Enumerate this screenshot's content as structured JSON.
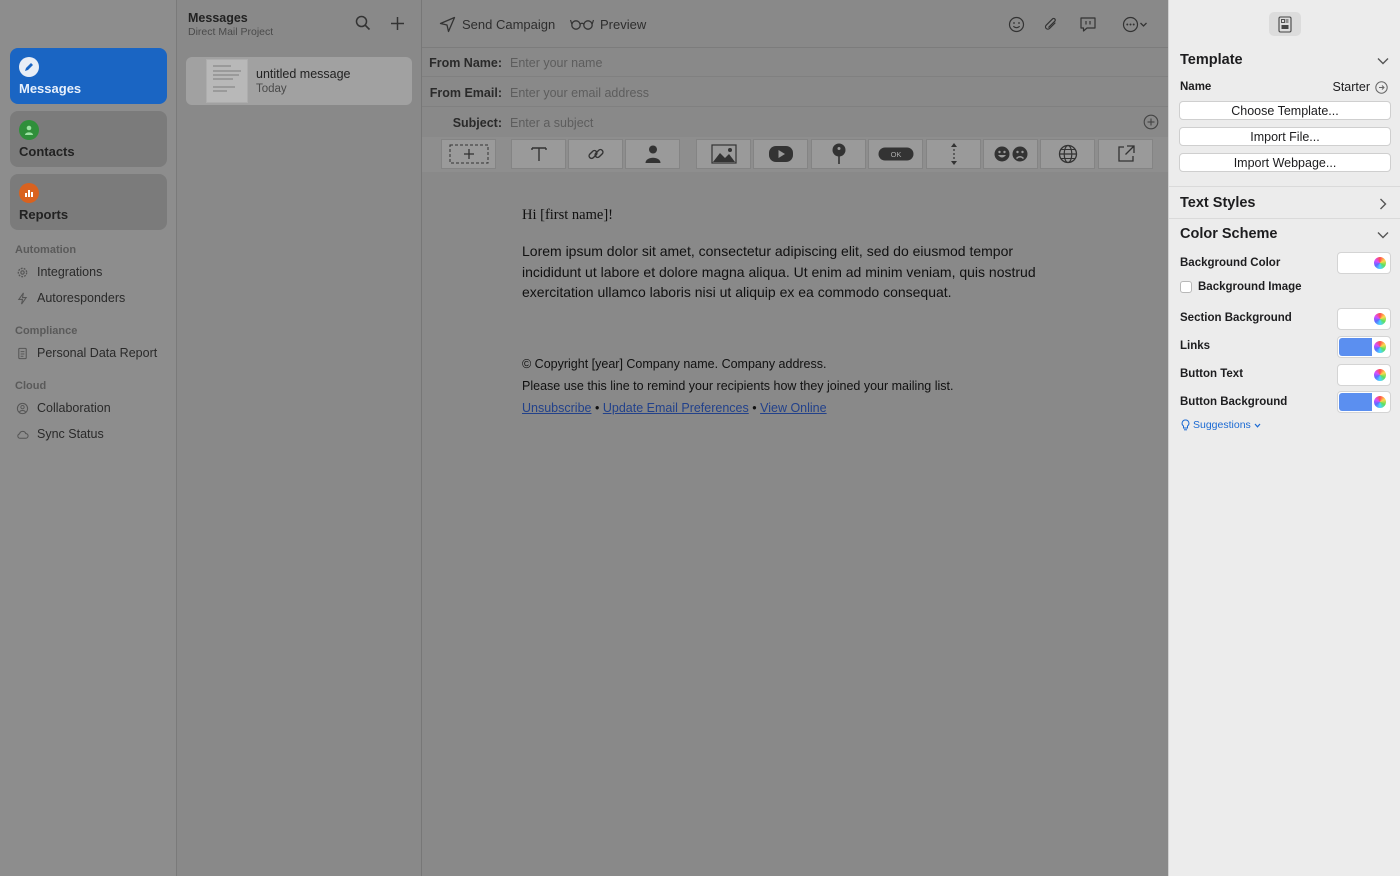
{
  "sidebar": {
    "nav": [
      {
        "label": "Messages",
        "icon": "pencil-icon",
        "active": true
      },
      {
        "label": "Contacts",
        "icon": "person-icon",
        "active": false
      },
      {
        "label": "Reports",
        "icon": "bar-chart-icon",
        "active": false
      }
    ],
    "sections": [
      {
        "title": "Automation",
        "items": [
          {
            "label": "Integrations",
            "icon": "gear-icon"
          },
          {
            "label": "Autoresponders",
            "icon": "bolt-icon"
          }
        ]
      },
      {
        "title": "Compliance",
        "items": [
          {
            "label": "Personal Data Report",
            "icon": "document-icon"
          }
        ]
      },
      {
        "title": "Cloud",
        "items": [
          {
            "label": "Collaboration",
            "icon": "person-circle-icon"
          },
          {
            "label": "Sync Status",
            "icon": "cloud-icon"
          }
        ]
      }
    ]
  },
  "message_list": {
    "title": "Messages",
    "subtitle": "Direct Mail Project",
    "items": [
      {
        "title": "untitled message",
        "date": "Today"
      }
    ]
  },
  "toolbar": {
    "send_label": "Send Campaign",
    "preview_label": "Preview"
  },
  "fields": {
    "from_name": {
      "label": "From Name:",
      "placeholder": "Enter your name",
      "value": ""
    },
    "from_email": {
      "label": "From Email:",
      "placeholder": "Enter your email address",
      "value": ""
    },
    "subject": {
      "label": "Subject:",
      "placeholder": "Enter a subject",
      "value": ""
    }
  },
  "block_buttons": [
    "add-block-icon",
    "text-icon",
    "link-icon",
    "person-icon",
    "image-icon",
    "video-icon",
    "map-pin-icon",
    "button-icon",
    "spacer-icon",
    "emoji-icon",
    "globe-icon",
    "share-icon"
  ],
  "block_button_text": "OK",
  "email": {
    "greeting": "Hi [first name]!",
    "body": "Lorem ipsum dolor sit amet, consectetur adipiscing elit, sed do eiusmod tempor incididunt ut labore et dolore magna aliqua. Ut enim ad minim veniam, quis nostrud exercitation ullamco laboris nisi ut aliquip ex ea commodo consequat.",
    "copyright": "© Copyright [year] Company name. Company address.",
    "reminder": "Please use this line to remind your recipients how they joined your mailing list.",
    "links": [
      "Unsubscribe",
      "Update Email Preferences",
      "View Online"
    ],
    "separator": "•"
  },
  "inspector": {
    "template": {
      "heading": "Template",
      "name_label": "Name",
      "name_value": "Starter",
      "buttons": [
        "Choose Template...",
        "Import File...",
        "Import Webpage..."
      ]
    },
    "text_styles_heading": "Text Styles",
    "color_scheme": {
      "heading": "Color Scheme",
      "background_color_label": "Background Color",
      "background_image_label": "Background Image",
      "section_background_label": "Section Background",
      "links_label": "Links",
      "button_text_label": "Button Text",
      "button_background_label": "Button Background",
      "colors": {
        "background": "#ffffff",
        "section_background": "#ffffff",
        "links": "#5b8ff0",
        "button_text": "#ffffff",
        "button_background": "#5b8ff0"
      },
      "suggestions_label": "Suggestions"
    }
  },
  "colors": {
    "accent": "#1a65c3",
    "contacts_icon": "#2f8f3a",
    "reports_icon": "#d9621f"
  }
}
